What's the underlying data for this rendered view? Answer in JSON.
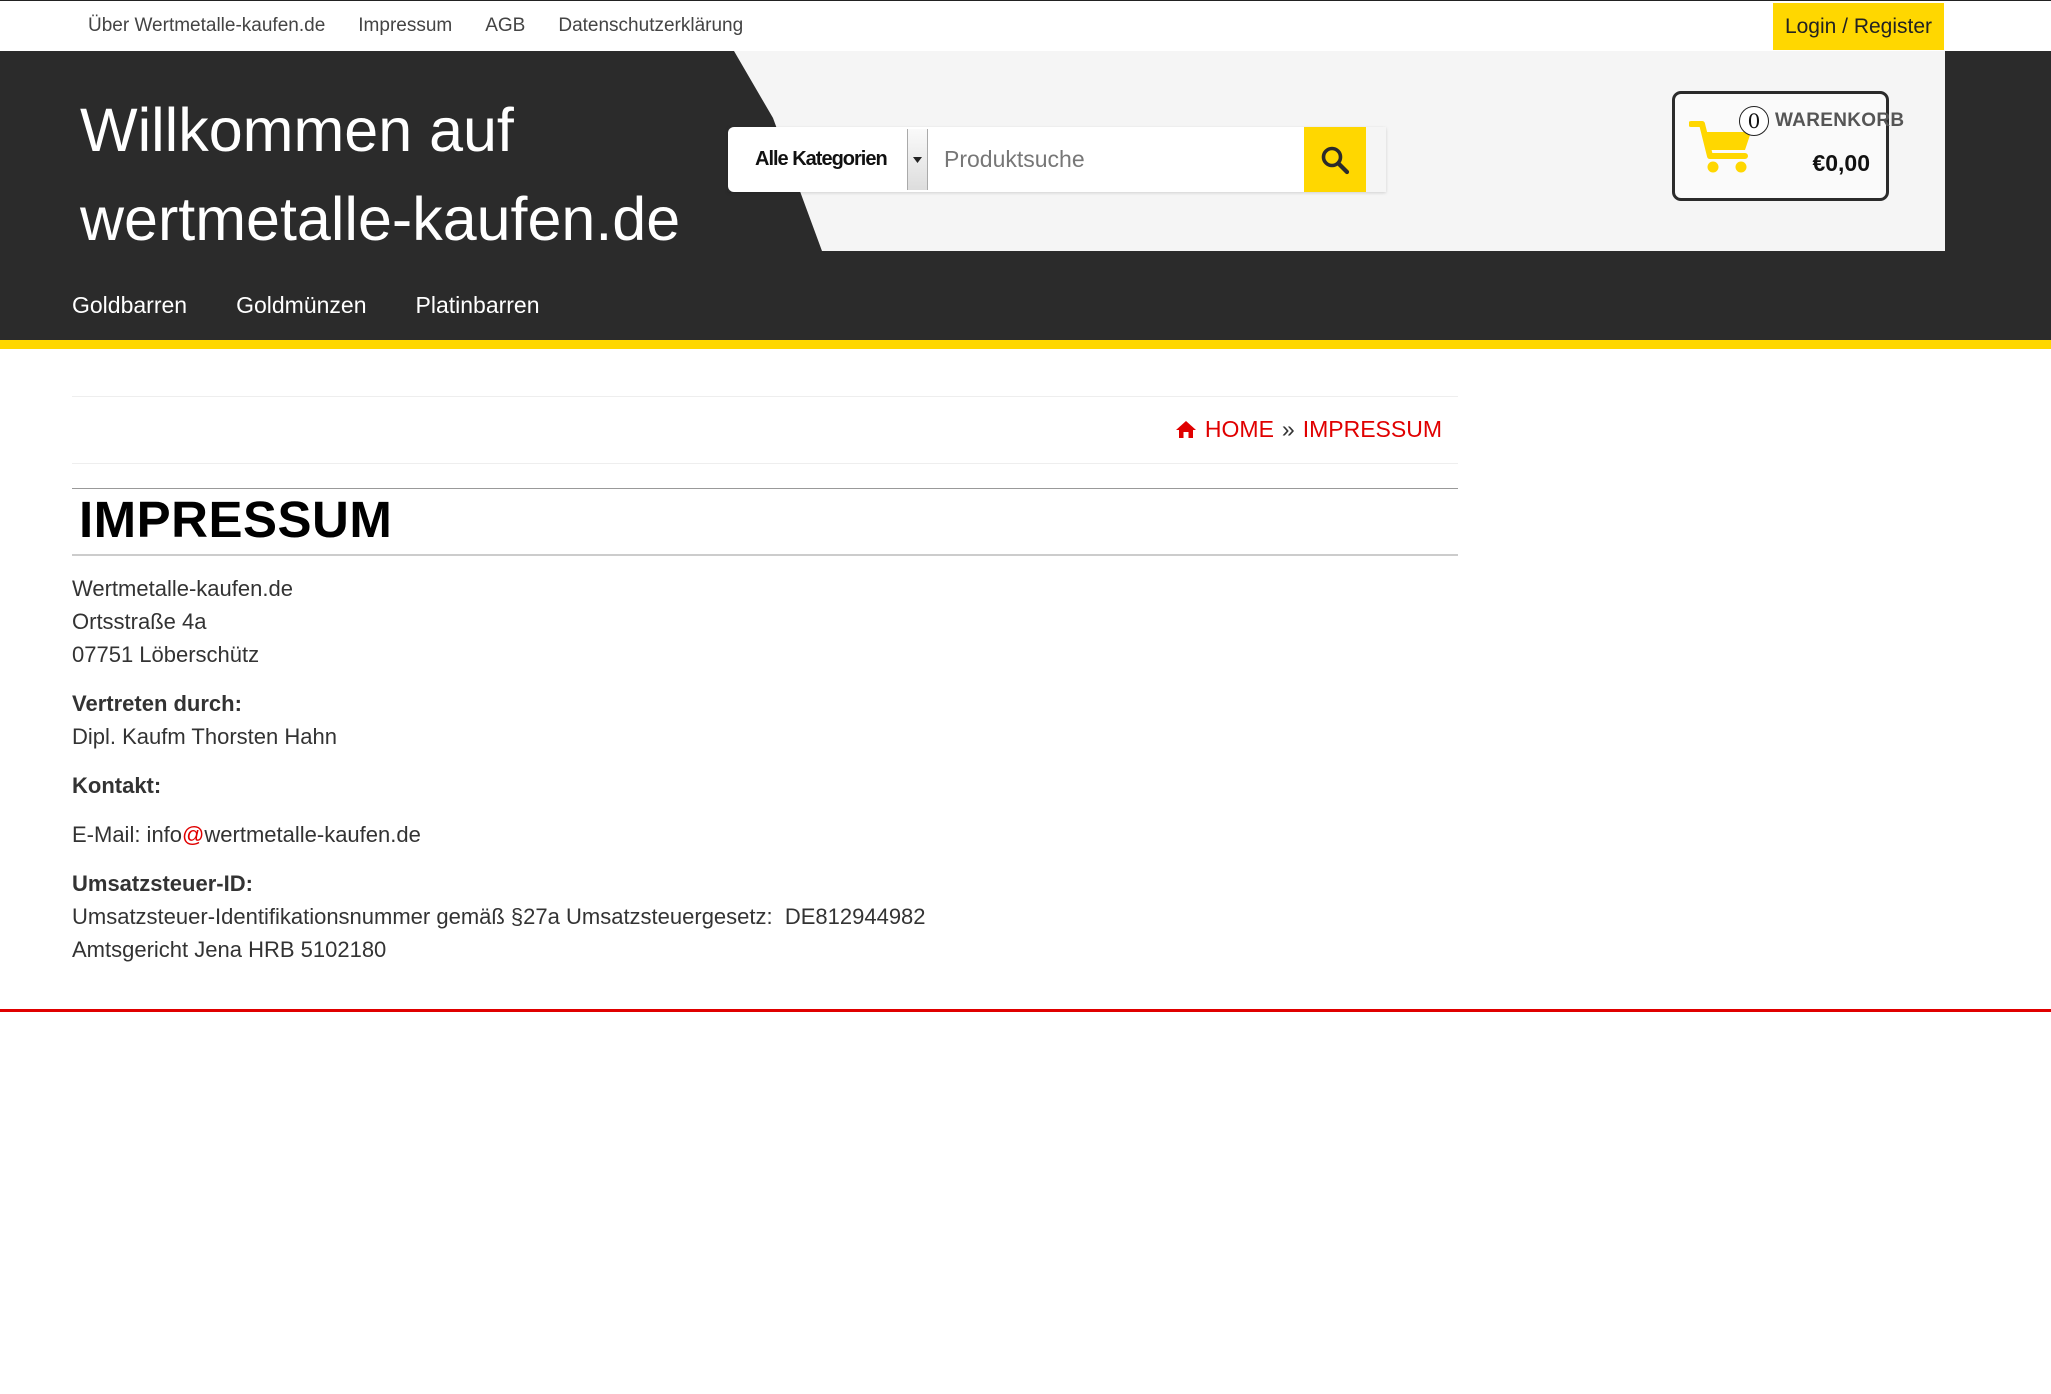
{
  "topbar": {
    "links": [
      "Über Wertmetalle-kaufen.de",
      "Impressum",
      "AGB",
      "Datenschutzerklärung"
    ],
    "login_label": "Login / Register"
  },
  "header": {
    "welcome_line1": "Willkommen auf",
    "welcome_line2": "wertmetalle-kaufen.de",
    "search": {
      "category_selected": "Alle Kategorien",
      "placeholder": "Produktsuche"
    },
    "cart": {
      "count": "0",
      "title": "WARENKORB",
      "total": "€0,00"
    },
    "nav": [
      "Goldbarren",
      "Goldmünzen",
      "Platinbarren"
    ]
  },
  "breadcrumb": {
    "home": "HOME",
    "separator": "»",
    "current": "IMPRESSUM"
  },
  "page": {
    "title": "IMPRESSUM",
    "address_line1": "Wertmetalle-kaufen.de",
    "address_line2": "Ortsstraße 4a",
    "address_line3": "07751 Löberschütz",
    "represented_label": "Vertreten durch:",
    "represented_value": "Dipl. Kaufm Thorsten Hahn",
    "contact_label": "Kontakt:",
    "email_prefix": "E-Mail: info",
    "email_at": "@",
    "email_domain": "wertmetalle-kaufen.de",
    "vat_label": "Umsatzsteuer-ID:",
    "vat_text": "Umsatzsteuer-Identifikationsnummer gemäß §27a Umsatzsteuergesetz:  DE812944982",
    "court_text": "Amtsgericht Jena HRB 5102180"
  },
  "colors": {
    "accent_yellow": "#ffd700",
    "header_dark": "#2b2b2b",
    "link_red": "#e00000"
  },
  "icons": [
    "search-icon",
    "cart-icon",
    "home-icon",
    "dropdown-arrow-icon"
  ]
}
